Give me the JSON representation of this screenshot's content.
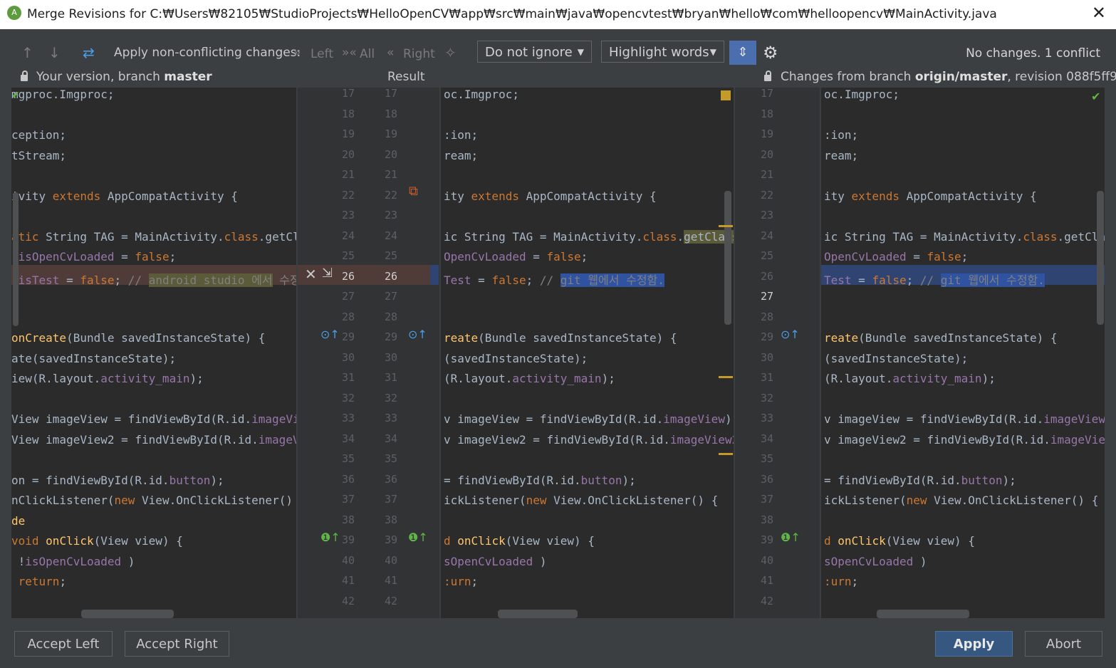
{
  "window": {
    "title": "Merge Revisions for C:₩Users₩82105₩StudioProjects₩HelloOpenCV₩app₩src₩main₩java₩opencvtest₩bryan₩hello₩com₩helloopencv₩MainActivity.java",
    "close": "✕"
  },
  "toolbar": {
    "apply_label": "Apply non-conflicting changes:",
    "left": "Left",
    "all": "All",
    "right": "Right",
    "whitespace": "Do not ignore",
    "highlight": "Highlight words",
    "status": "No changes. 1 conflict"
  },
  "headers": {
    "left_prefix": "Your version, branch ",
    "left_branch": "master",
    "middle": "Result",
    "right_prefix": "Changes from branch ",
    "right_branch": "origin/master",
    "right_suffix": ", revision 088f5ff9"
  },
  "line_numbers": [
    "17",
    "18",
    "19",
    "20",
    "21",
    "22",
    "23",
    "24",
    "25",
    "26",
    "27",
    "28",
    "29",
    "30",
    "31",
    "32",
    "33",
    "34",
    "35",
    "36",
    "37",
    "38",
    "39",
    "40",
    "41",
    "42"
  ],
  "buttons": {
    "accept_left": "Accept Left",
    "accept_right": "Accept Right",
    "apply": "Apply",
    "abort": "Abort"
  },
  "colors": {
    "accent": "#4b6eaf",
    "conflict_left": "#4f3b38",
    "conflict_right": "#2f4470",
    "keyword": "#cc7832",
    "method": "#ffc66d",
    "field": "#9876aa"
  }
}
